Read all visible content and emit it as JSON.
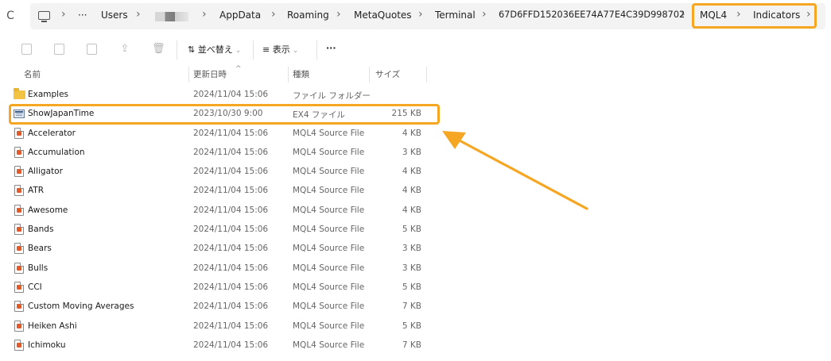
{
  "address_bar": {
    "more": "···",
    "segments": [
      "Users",
      "AppData",
      "Roaming",
      "MetaQuotes",
      "Terminal",
      "67D6FFD152036EE74A77E4C39D998702",
      "MQL4",
      "Indicators"
    ],
    "separator": "›"
  },
  "toolbar": {
    "sort_label": "並べ替え",
    "view_label": "表示",
    "more_label": "···"
  },
  "columns": {
    "name": "名前",
    "modified": "更新日時",
    "type": "種類",
    "size": "サイズ"
  },
  "files": [
    {
      "icon": "folder-icon",
      "name": "Examples",
      "modified": "2024/11/04 15:06",
      "type": "ファイル フォルダー",
      "size": ""
    },
    {
      "icon": "executable-file-icon",
      "name": "ShowJapanTime",
      "modified": "2023/10/30 9:00",
      "type": "EX4 ファイル",
      "size": "215 KB"
    },
    {
      "icon": "source-file-icon",
      "name": "Accelerator",
      "modified": "2024/11/04 15:06",
      "type": "MQL4 Source File",
      "size": "4 KB"
    },
    {
      "icon": "source-file-icon",
      "name": "Accumulation",
      "modified": "2024/11/04 15:06",
      "type": "MQL4 Source File",
      "size": "3 KB"
    },
    {
      "icon": "source-file-icon",
      "name": "Alligator",
      "modified": "2024/11/04 15:06",
      "type": "MQL4 Source File",
      "size": "4 KB"
    },
    {
      "icon": "source-file-icon",
      "name": "ATR",
      "modified": "2024/11/04 15:06",
      "type": "MQL4 Source File",
      "size": "4 KB"
    },
    {
      "icon": "source-file-icon",
      "name": "Awesome",
      "modified": "2024/11/04 15:06",
      "type": "MQL4 Source File",
      "size": "4 KB"
    },
    {
      "icon": "source-file-icon",
      "name": "Bands",
      "modified": "2024/11/04 15:06",
      "type": "MQL4 Source File",
      "size": "5 KB"
    },
    {
      "icon": "source-file-icon",
      "name": "Bears",
      "modified": "2024/11/04 15:06",
      "type": "MQL4 Source File",
      "size": "3 KB"
    },
    {
      "icon": "source-file-icon",
      "name": "Bulls",
      "modified": "2024/11/04 15:06",
      "type": "MQL4 Source File",
      "size": "3 KB"
    },
    {
      "icon": "source-file-icon",
      "name": "CCI",
      "modified": "2024/11/04 15:06",
      "type": "MQL4 Source File",
      "size": "5 KB"
    },
    {
      "icon": "source-file-icon",
      "name": "Custom Moving Averages",
      "modified": "2024/11/04 15:06",
      "type": "MQL4 Source File",
      "size": "7 KB"
    },
    {
      "icon": "source-file-icon",
      "name": "Heiken Ashi",
      "modified": "2024/11/04 15:06",
      "type": "MQL4 Source File",
      "size": "5 KB"
    },
    {
      "icon": "source-file-icon",
      "name": "Ichimoku",
      "modified": "2024/11/04 15:06",
      "type": "MQL4 Source File",
      "size": "7 KB"
    }
  ],
  "colors": {
    "highlight": "#f5a623",
    "address_bg": "#f3f3f3"
  }
}
